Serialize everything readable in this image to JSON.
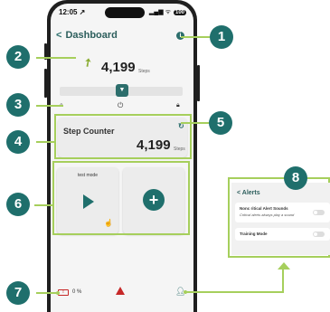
{
  "status_bar": {
    "time": "12:05 ↗",
    "signal": "▂▄▆ ᯤ",
    "battery": "100"
  },
  "nav": {
    "back": "<",
    "title": "Dashboard"
  },
  "info": "i",
  "hero": {
    "steps": "4,199",
    "unit": "Steps"
  },
  "slider_icon": "▼",
  "step_card": {
    "label": "Step Counter",
    "value": "4,199",
    "unit": "Steps"
  },
  "tiles": [
    {
      "label": "test mode"
    },
    {
      "label": ""
    }
  ],
  "plus": "+",
  "bottom_bar": {
    "battery_pct": "0 %"
  },
  "callouts": [
    "1",
    "2",
    "3",
    "4",
    "5",
    "6",
    "7",
    "8"
  ],
  "alerts": {
    "back": "<",
    "title": "Alerts",
    "rows": [
      {
        "title": "Nonc ritical Alert Sounds",
        "subtitle": "Critical alerts always play a sound"
      },
      {
        "title": "Training Mode",
        "subtitle": ""
      }
    ]
  },
  "colors": {
    "accent": "#1f6f6c",
    "highlight": "#a6cf5c",
    "warning": "#c62828"
  }
}
